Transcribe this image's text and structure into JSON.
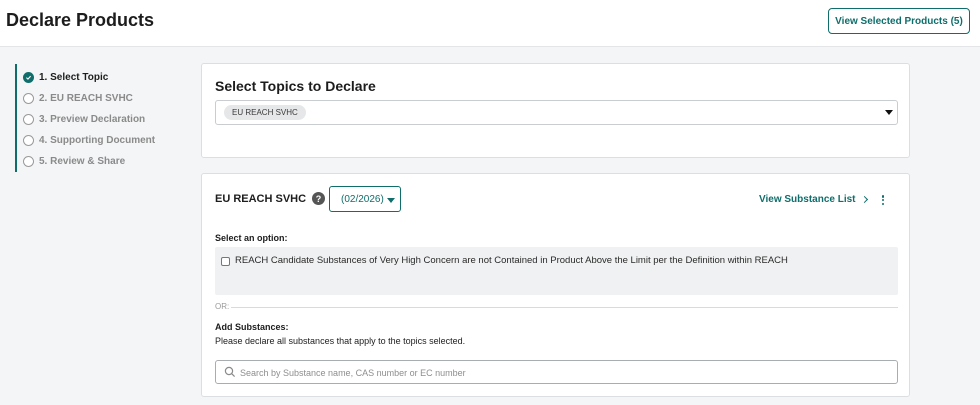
{
  "header": {
    "title": "Declare Products",
    "view_selected_label": "View Selected Products (5)"
  },
  "stepper": {
    "steps": [
      {
        "label": "1. Select Topic",
        "state": "active"
      },
      {
        "label": "2. EU REACH SVHC",
        "state": "pending"
      },
      {
        "label": "3. Preview Declaration",
        "state": "pending"
      },
      {
        "label": "4. Supporting Document",
        "state": "pending"
      },
      {
        "label": "5. Review & Share",
        "state": "pending"
      }
    ]
  },
  "topics_card": {
    "heading": "Select Topics to Declare",
    "selected_chips": [
      "EU REACH SVHC"
    ]
  },
  "reach_card": {
    "title": "EU REACH SVHC",
    "help_icon": "question-circle-icon",
    "period_value": "(02/2026)",
    "view_substance_label": "View Substance List",
    "option_label": "Select an option:",
    "option_text": "REACH Candidate Substances of Very High Concern are not Contained in Product Above the Limit per the Definition within REACH",
    "or_label": "OR:",
    "add_label": "Add Substances:",
    "add_help": "Please declare all substances that apply to the topics selected.",
    "search_placeholder": "Search by Substance name, CAS number or EC number"
  },
  "colors": {
    "accent": "#0f6e6b",
    "background": "#f4f5f6"
  }
}
